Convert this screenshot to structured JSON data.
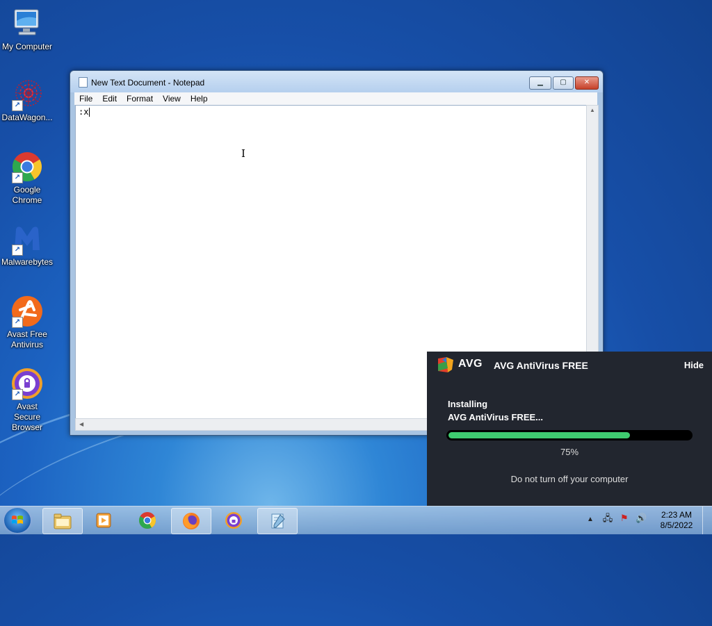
{
  "desktop": {
    "icons": [
      {
        "label": "My Computer"
      },
      {
        "label": "DataWagon..."
      },
      {
        "label": "Google Chrome"
      },
      {
        "label": "Malwarebytes"
      },
      {
        "label": "Avast Free Antivirus"
      },
      {
        "label": "Avast Secure Browser"
      }
    ]
  },
  "notepad": {
    "title": "New Text Document - Notepad",
    "menu": [
      "File",
      "Edit",
      "Format",
      "View",
      "Help"
    ],
    "content": ":x",
    "buttons": {
      "minimize": "▁",
      "maximize": "▢",
      "close": "✕"
    }
  },
  "avg": {
    "logo_text": "AVG",
    "app_name": "AVG AntiVirus FREE",
    "hide_label": "Hide",
    "status_line1": "Installing",
    "status_line2": "AVG AntiVirus FREE...",
    "progress_text": "75%",
    "progress_fraction": 0.75,
    "note": "Do not turn off your computer",
    "colors": {
      "bg": "#22262f",
      "progress": "#3fcb6f"
    }
  },
  "taskbar": {
    "items": [
      "windows-explorer",
      "media-player",
      "google-chrome",
      "firefox",
      "avast-secure-browser",
      "notepad"
    ],
    "time": "2:23 AM",
    "date": "8/5/2022"
  }
}
